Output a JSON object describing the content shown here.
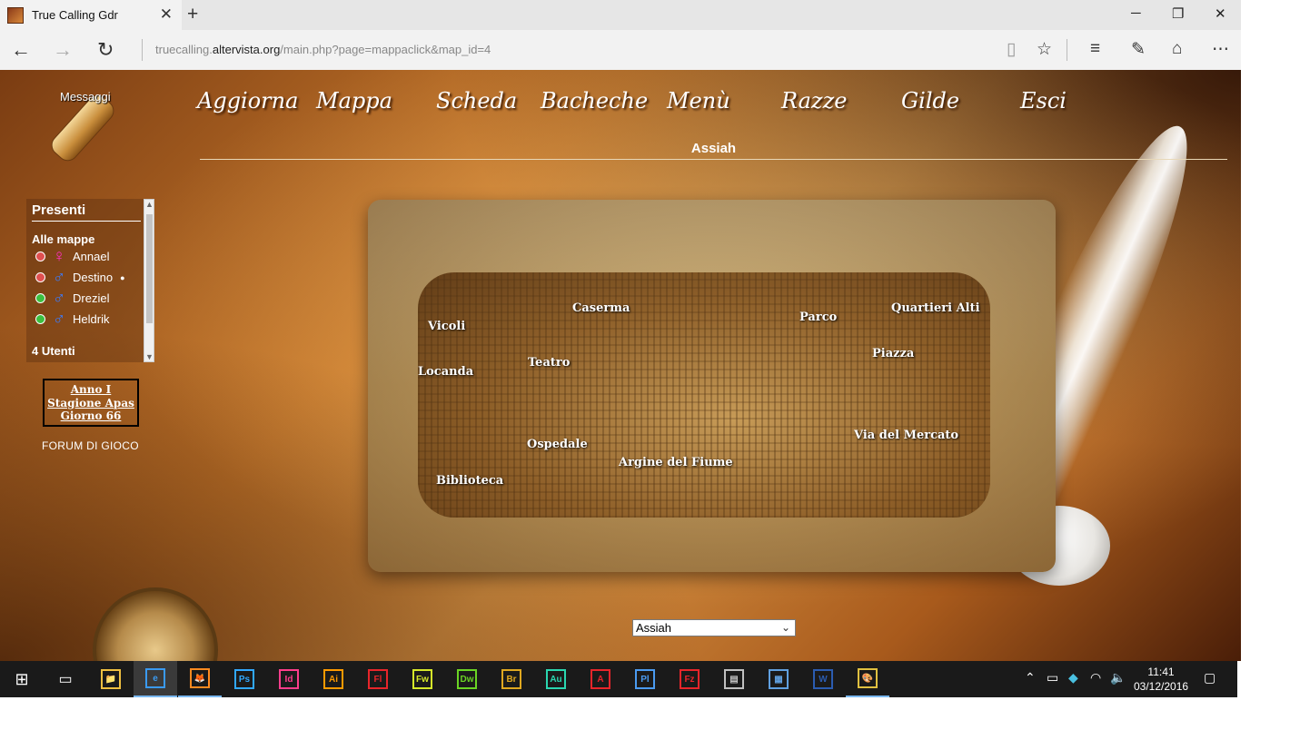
{
  "browser": {
    "tab_title": "True Calling Gdr",
    "tab_close": "✕",
    "new_tab": "+",
    "url_prefix": "truecalling.",
    "url_domain": "altervista.org",
    "url_path": "/main.php?page=mappaclick&map_id=4",
    "icons": {
      "back": "back-arrow-icon",
      "forward": "forward-arrow-icon",
      "refresh": "refresh-icon",
      "reading_view": "reading-view-icon",
      "favorite": "star-icon",
      "hub": "hub-icon",
      "web_note": "web-note-icon",
      "share": "share-icon",
      "more": "more-icon"
    }
  },
  "site": {
    "messages_label": "Messaggi",
    "menu": [
      "Aggiorna",
      "Mappa",
      "Scheda",
      "Bacheche",
      "Menù",
      "Razze",
      "Gilde",
      "Esci"
    ],
    "map_title": "Assiah",
    "presenti": {
      "heading": "Presenti",
      "subheading": "Alle mappe",
      "users": [
        {
          "name": "Annael",
          "status_color": "#e05050",
          "sex": "♀",
          "sex_color": "#ff2fc0",
          "pin": ""
        },
        {
          "name": "Destino",
          "status_color": "#e05050",
          "sex": "♂",
          "sex_color": "#3a7cff",
          "pin": "●"
        },
        {
          "name": "Dreziel",
          "status_color": "#3cc040",
          "sex": "♂",
          "sex_color": "#3a7cff",
          "pin": ""
        },
        {
          "name": "Heldrik",
          "status_color": "#3cc040",
          "sex": "♂",
          "sex_color": "#3a7cff",
          "pin": ""
        }
      ],
      "count": "4 Utenti"
    },
    "date": {
      "line1": "Anno I",
      "line2": "Stagione Apas",
      "line3": "Giorno 66"
    },
    "forum": "FORUM DI GIOCO",
    "locations": [
      "Caserma",
      "Vicoli",
      "Parco",
      "Quartieri Alti",
      "Piazza",
      "Teatro",
      "Locanda",
      "Via del Mercato",
      "Ospedale",
      "Argine del Fiume",
      "Biblioteca"
    ],
    "map_select": {
      "value": "Assiah"
    }
  },
  "taskbar": {
    "apps": [
      {
        "name": "file-explorer",
        "label": "📁",
        "color": "#f0c040"
      },
      {
        "name": "edge",
        "label": "e",
        "color": "#3a9af0"
      },
      {
        "name": "firefox",
        "label": "🦊",
        "color": "#ff8a20"
      },
      {
        "name": "photoshop",
        "label": "Ps",
        "color": "#31a8ff"
      },
      {
        "name": "indesign",
        "label": "Id",
        "color": "#ff3d8b"
      },
      {
        "name": "illustrator",
        "label": "Ai",
        "color": "#ff9a00"
      },
      {
        "name": "flash",
        "label": "Fl",
        "color": "#e8252a"
      },
      {
        "name": "fireworks",
        "label": "Fw",
        "color": "#d6e82a"
      },
      {
        "name": "dreamweaver",
        "label": "Dw",
        "color": "#6ad424"
      },
      {
        "name": "bridge",
        "label": "Br",
        "color": "#e0a820"
      },
      {
        "name": "audition",
        "label": "Au",
        "color": "#2ad6b0"
      },
      {
        "name": "acrobat",
        "label": "A",
        "color": "#e8252a"
      },
      {
        "name": "prelude",
        "label": "Pl",
        "color": "#4a9af0"
      },
      {
        "name": "filezilla",
        "label": "Fz",
        "color": "#e8252a"
      },
      {
        "name": "printer-app",
        "label": "▤",
        "color": "#c0c0c0"
      },
      {
        "name": "control-panel",
        "label": "▦",
        "color": "#60a0e0"
      },
      {
        "name": "word",
        "label": "W",
        "color": "#2b5cb0"
      },
      {
        "name": "paint",
        "label": "🎨",
        "color": "#e0c040"
      }
    ],
    "time": "11:41",
    "date": "03/12/2016"
  }
}
